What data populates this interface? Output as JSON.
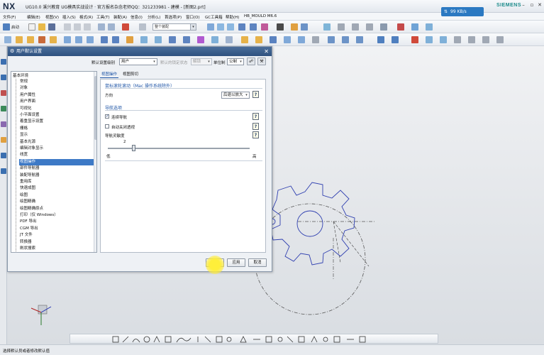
{
  "window": {
    "app_logo": "NX",
    "title": "UG10.0 溪兴教育 UG模具实战设计 · 官方报名杂念老师QQ：321233981 - 建模 - [新图2.prt]",
    "brand": "SIEMENS",
    "net_speed": "99 KB/s"
  },
  "menu": {
    "items": [
      "文件(F)",
      "编辑(E)",
      "视图(V)",
      "插入(S)",
      "格式(R)",
      "工具(T)",
      "装配(A)",
      "信息(I)",
      "分析(L)",
      "首选项(P)",
      "窗口(O)",
      "GC工具箱",
      "帮助(H)",
      "HB_MOULD M6.6"
    ]
  },
  "toolbar": {
    "start_label": "启动",
    "filter_value": "整个装配"
  },
  "dialog": {
    "title": "用户默认设置",
    "level_label": "默认设置级别",
    "level_value": "用户",
    "lock_label": "默认的锁定状态",
    "lock_value": "解锁",
    "units_label": "单位制",
    "units_value": "公制",
    "tree_root": "基本环境",
    "tree_items": [
      "常规",
      "对象",
      "用户属性",
      "用户界面",
      "可视化",
      "小平面设置",
      "着重显示设置",
      "栅格",
      "显示",
      "基本光源",
      "编辑对象显示",
      "线宽",
      "视图操作",
      "部件导航器",
      "装配导航器",
      "重用库",
      "快速成图",
      "绘图",
      "绘图精确",
      "绘图精确原点",
      "打印（仅 Windows）",
      "PDF 导出",
      "CGM 导出",
      "JT 文件",
      "转换器",
      "刷状搜索"
    ],
    "selected_item": "视图操作",
    "tabs": [
      "视图操作",
      "视图剪切"
    ],
    "active_tab": "视图操作",
    "wheel_section": "鼠标滚轮滚动（Mac 操作系统除外）",
    "direction_label": "方向",
    "direction_value": "后退以放大",
    "nav_section": "导航选项",
    "nav_continuous": "连续导航",
    "auto_perspective": "自动关闭透视",
    "sensitivity_label": "导航灵敏度",
    "sensitivity_value": "2",
    "slider_low": "低",
    "slider_high": "高",
    "ok_button": "确定",
    "apply_button": "应用",
    "cancel_button": "取消"
  },
  "status": {
    "message": "选择默认员或者修改默认值"
  },
  "colors": {
    "title_bar": "#2f5280",
    "selection": "#3d79c6",
    "accent_text": "#1f55a6",
    "gear_outline": "#2f3fb0"
  }
}
